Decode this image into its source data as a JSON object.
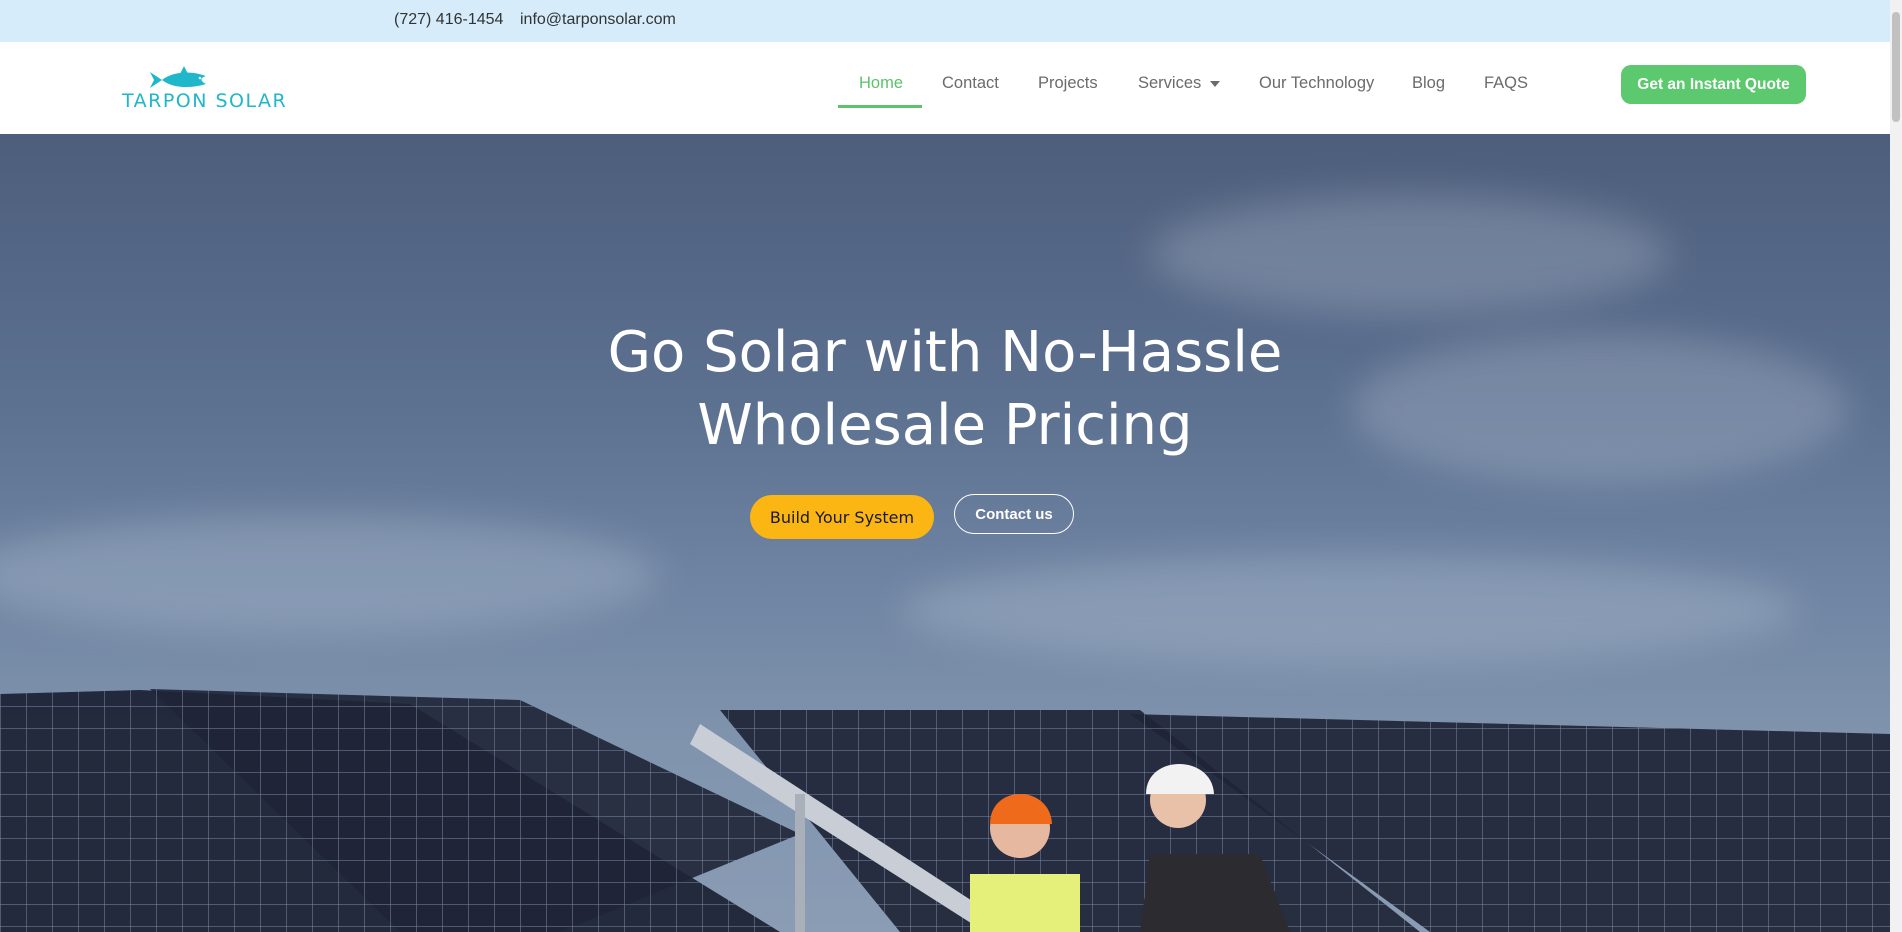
{
  "topbar": {
    "phone": "(727) 416-1454",
    "email": "info@tarponsolar.com"
  },
  "brand": {
    "name": "TARPON SOLAR",
    "logo_icon": "tarpon-fish-icon",
    "logo_color": "#1fb7c9"
  },
  "nav": {
    "items": [
      {
        "label": "Home",
        "active": true
      },
      {
        "label": "Contact"
      },
      {
        "label": "Projects"
      },
      {
        "label": "Services",
        "has_dropdown": true
      },
      {
        "label": "Our Technology"
      },
      {
        "label": "Blog"
      },
      {
        "label": "FAQS"
      }
    ],
    "quote_button": "Get an Instant Quote"
  },
  "hero": {
    "headline_line1": "Go Solar with No-Hassle",
    "headline_line2": "Wholesale Pricing",
    "primary_button": "Build Your System",
    "secondary_button": "Contact us"
  },
  "colors": {
    "topbar_bg": "#d6ecfb",
    "accent_green": "#5cc26b",
    "button_yellow": "#fbb614",
    "hero_sky": "#5d7191"
  }
}
